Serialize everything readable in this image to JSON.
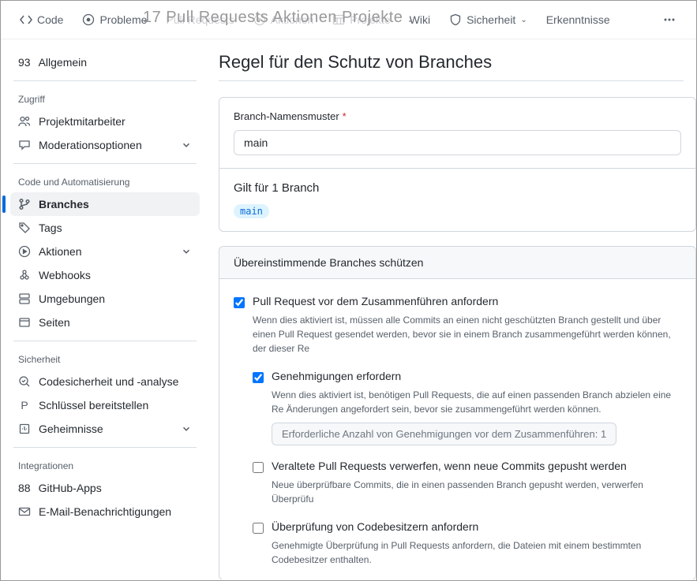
{
  "topnav": {
    "code": "Code",
    "issues": "Probleme",
    "issues_count": "17",
    "pullreq": "Pull Requests",
    "actions": "Aktionen",
    "projects": "Projekte",
    "wiki": "Wiki",
    "security": "Sicherheit",
    "insights": "Erkenntnisse",
    "overlay": "17 Pull Requests Aktionen  Projekte ."
  },
  "sidebar": {
    "general_count": "93",
    "general": "Allgemein",
    "access": "Zugriff",
    "collab": "Projektmitarbeiter",
    "moderation": "Moderationsoptionen",
    "codeauto": "Code und Automatisierung",
    "branches": "Branches",
    "tags": "Tags",
    "actions": "Aktionen",
    "webhooks": "Webhooks",
    "environments": "Umgebungen",
    "pages": "Seiten",
    "security": "Sicherheit",
    "codesec": "Codesicherheit und -analyse",
    "deploykeys_prefix": "P",
    "deploykeys": "Schlüssel bereitstellen",
    "secrets": "Geheimnisse",
    "integrations": "Integrationen",
    "apps_count": "88",
    "apps": "GitHub-Apps",
    "email": "E-Mail-Benachrichtigungen"
  },
  "main": {
    "title": "Regel für den Schutz von Branches",
    "pattern_label": "Branch-Namensmuster",
    "pattern_value": "main",
    "applies_to": "Gilt für 1 Branch",
    "branch_pill": "main",
    "protect_header": "Übereinstimmende Branches schützen",
    "opt1_label": "Pull Request vor dem Zusammenführen anfordern",
    "opt1_desc": "Wenn dies aktiviert ist, müssen alle Commits an einen nicht geschützten Branch gestellt und über einen Pull Request gesendet werden, bevor sie in einem Branch zusammengeführt werden können, der dieser Re",
    "opt1a_label": "Genehmigungen erfordern",
    "opt1a_desc": "Wenn dies aktiviert ist, benötigen Pull Requests, die auf einen passenden Branch abzielen eine Re Änderungen angefordert sein, bevor sie zusammengeführt werden können.",
    "reviews_label": "Erforderliche Anzahl von Genehmigungen vor dem Zusammenführen: 1",
    "opt1b_label": "Veraltete Pull Requests verwerfen, wenn neue Commits gepusht werden",
    "opt1b_desc": "Neue überprüfbare Commits, die in einen passenden Branch gepusht werden, verwerfen Überprüfu",
    "opt1c_label": "Überprüfung von Codebesitzern anfordern",
    "opt1c_desc": "Genehmigte Überprüfung in Pull Requests anfordern, die Dateien mit einem bestimmten Codebesitzer enthalten."
  }
}
